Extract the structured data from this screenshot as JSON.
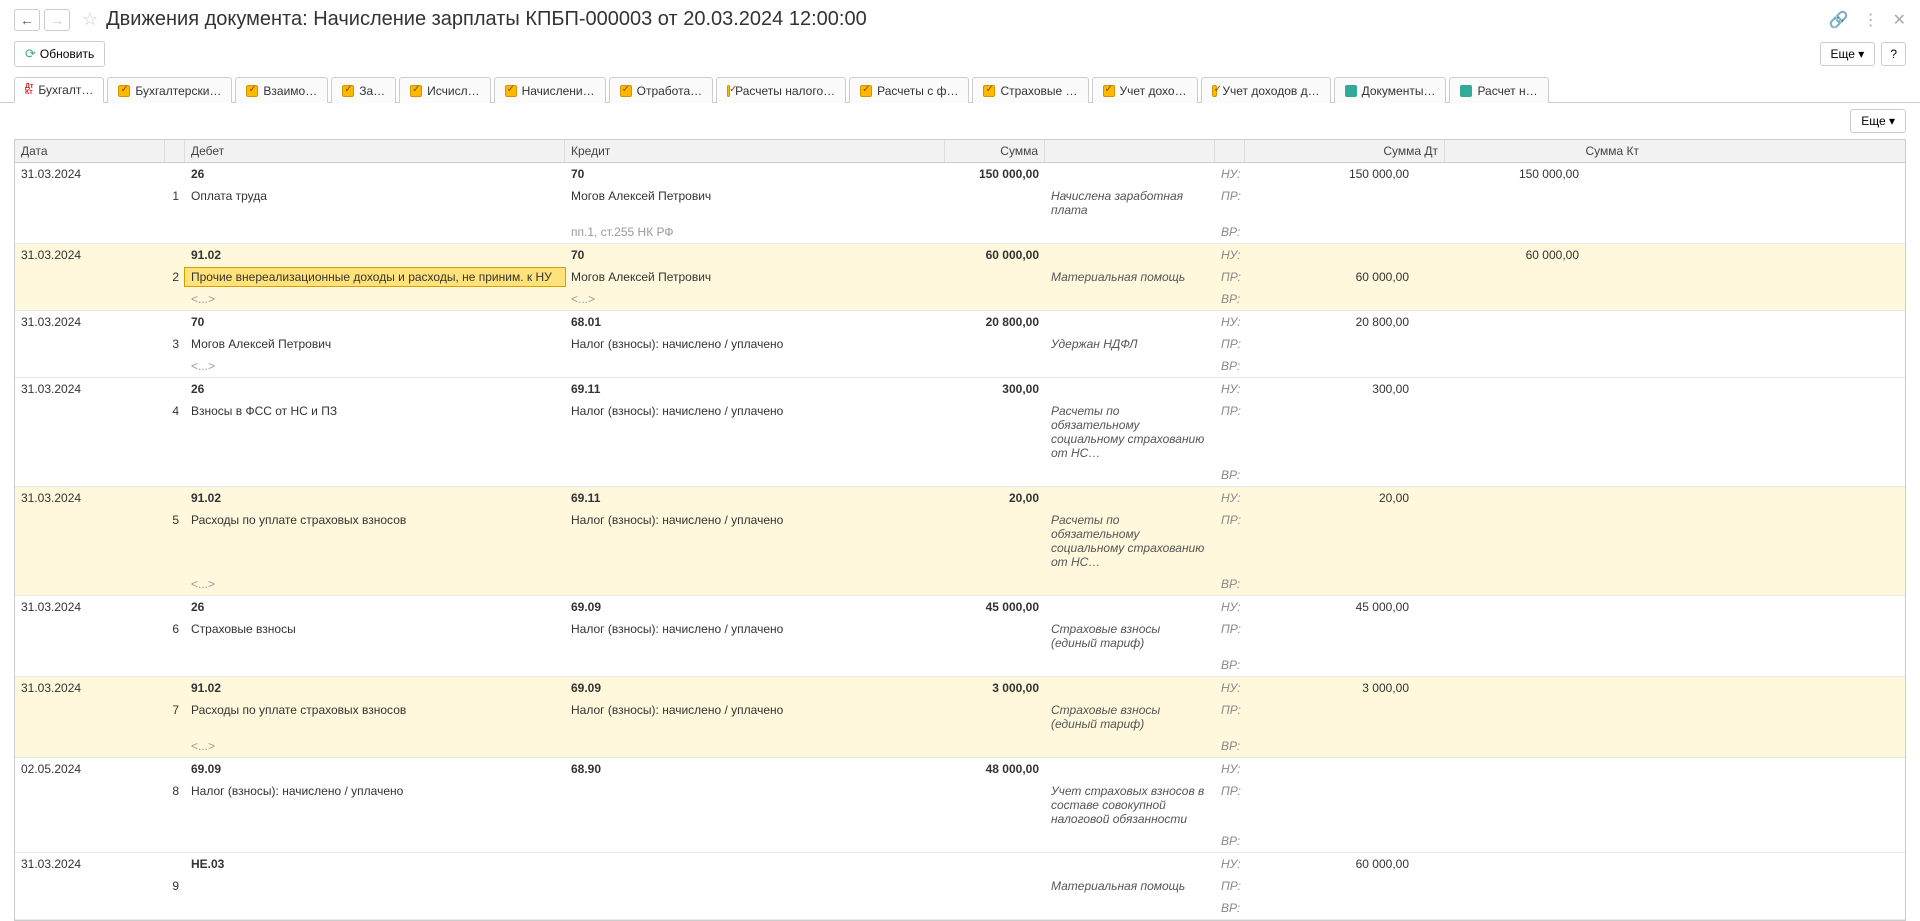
{
  "header": {
    "title": "Движения документа: Начисление зарплаты КПБП-000003 от 20.03.2024 12:00:00"
  },
  "toolbar": {
    "refresh_label": "Обновить",
    "more_label": "Еще",
    "help_label": "?"
  },
  "tabs": [
    {
      "label": "Бухгалт…",
      "icon": "r",
      "active": true
    },
    {
      "label": "Бухгалтерски…",
      "icon": "y"
    },
    {
      "label": "Взаимо…",
      "icon": "y"
    },
    {
      "label": "За…",
      "icon": "y"
    },
    {
      "label": "Исчисл…",
      "icon": "y"
    },
    {
      "label": "Начислени…",
      "icon": "y"
    },
    {
      "label": "Отработа…",
      "icon": "y"
    },
    {
      "label": "Расчеты налого…",
      "icon": "y"
    },
    {
      "label": "Расчеты с ф…",
      "icon": "y"
    },
    {
      "label": "Страховые …",
      "icon": "y"
    },
    {
      "label": "Учет дохо…",
      "icon": "y"
    },
    {
      "label": "Учет доходов д…",
      "icon": "y"
    },
    {
      "label": "Документы…",
      "icon": "g"
    },
    {
      "label": "Расчет н…",
      "icon": "g"
    }
  ],
  "grid_headers": {
    "date": "Дата",
    "debit": "Дебет",
    "credit": "Кредит",
    "sum": "Сумма",
    "sum_dt": "Сумма Дт",
    "sum_kt": "Сумма Кт"
  },
  "labels": {
    "nu": "НУ:",
    "pr": "ПР:",
    "vr": "ВР:"
  },
  "entries": [
    {
      "yellow": false,
      "date": "31.03.2024",
      "no": "1",
      "debit_acc": "26",
      "debit_sub": "Оплата труда",
      "debit_sub2": "",
      "credit_acc": "70",
      "credit_sub": "Могов Алексей Петрович",
      "credit_sub2": "пп.1, ст.255 НК РФ",
      "sum": "150 000,00",
      "desc": "Начислена заработная плата",
      "dt": "150 000,00",
      "kt": "150 000,00",
      "dt2": "",
      "kt2": ""
    },
    {
      "yellow": true,
      "date": "31.03.2024",
      "no": "2",
      "debit_acc": "91.02",
      "debit_sub": "Прочие внереализационные доходы и расходы, не приним. к НУ",
      "debit_sub2": "<...>",
      "credit_acc": "70",
      "credit_sub": "Могов Алексей Петрович",
      "credit_sub2": "<...>",
      "sum": "60 000,00",
      "desc": "Материальная помощь",
      "dt": "",
      "kt": "60 000,00",
      "dt2": "60 000,00",
      "kt2": "",
      "selected": true
    },
    {
      "yellow": false,
      "date": "31.03.2024",
      "no": "3",
      "debit_acc": "70",
      "debit_sub": "Могов Алексей Петрович",
      "debit_sub2": "<...>",
      "credit_acc": "68.01",
      "credit_sub": "Налог (взносы): начислено / уплачено",
      "credit_sub2": "",
      "sum": "20 800,00",
      "desc": "Удержан НДФЛ",
      "dt": "20 800,00",
      "kt": "",
      "dt2": "",
      "kt2": ""
    },
    {
      "yellow": false,
      "date": "31.03.2024",
      "no": "4",
      "debit_acc": "26",
      "debit_sub": "Взносы в ФСС от НС и ПЗ",
      "debit_sub2": "",
      "credit_acc": "69.11",
      "credit_sub": "Налог (взносы): начислено / уплачено",
      "credit_sub2": "",
      "sum": "300,00",
      "desc": "Расчеты по обязательному социальному страхованию от НС…",
      "dt": "300,00",
      "kt": "",
      "dt2": "",
      "kt2": ""
    },
    {
      "yellow": true,
      "date": "31.03.2024",
      "no": "5",
      "debit_acc": "91.02",
      "debit_sub": "Расходы по уплате страховых взносов",
      "debit_sub2": "<...>",
      "credit_acc": "69.11",
      "credit_sub": "Налог (взносы): начислено / уплачено",
      "credit_sub2": "",
      "sum": "20,00",
      "desc": "Расчеты по обязательному социальному страхованию от НС…",
      "dt": "20,00",
      "kt": "",
      "dt2": "",
      "kt2": ""
    },
    {
      "yellow": false,
      "date": "31.03.2024",
      "no": "6",
      "debit_acc": "26",
      "debit_sub": "Страховые взносы",
      "debit_sub2": "",
      "credit_acc": "69.09",
      "credit_sub": "Налог (взносы): начислено / уплачено",
      "credit_sub2": "",
      "sum": "45 000,00",
      "desc": "Страховые взносы (единый тариф)",
      "dt": "45 000,00",
      "kt": "",
      "dt2": "",
      "kt2": ""
    },
    {
      "yellow": true,
      "date": "31.03.2024",
      "no": "7",
      "debit_acc": "91.02",
      "debit_sub": "Расходы по уплате страховых взносов",
      "debit_sub2": "<...>",
      "credit_acc": "69.09",
      "credit_sub": "Налог (взносы): начислено / уплачено",
      "credit_sub2": "",
      "sum": "3 000,00",
      "desc": "Страховые взносы (единый тариф)",
      "dt": "3 000,00",
      "kt": "",
      "dt2": "",
      "kt2": ""
    },
    {
      "yellow": false,
      "date": "02.05.2024",
      "no": "8",
      "debit_acc": "69.09",
      "debit_sub": "Налог (взносы): начислено / уплачено",
      "debit_sub2": "",
      "credit_acc": "68.90",
      "credit_sub": "",
      "credit_sub2": "",
      "sum": "48 000,00",
      "desc": "Учет страховых взносов в составе совокупной налоговой обязанности",
      "dt": "",
      "kt": "",
      "dt2": "",
      "kt2": ""
    },
    {
      "yellow": false,
      "date": "31.03.2024",
      "no": "9",
      "debit_acc": "НЕ.03",
      "debit_sub": "",
      "debit_sub2": "",
      "credit_acc": "",
      "credit_sub": "",
      "credit_sub2": "",
      "sum": "",
      "desc": "Материальная помощь",
      "dt": "60 000,00",
      "kt": "",
      "dt2": "",
      "kt2": ""
    }
  ]
}
